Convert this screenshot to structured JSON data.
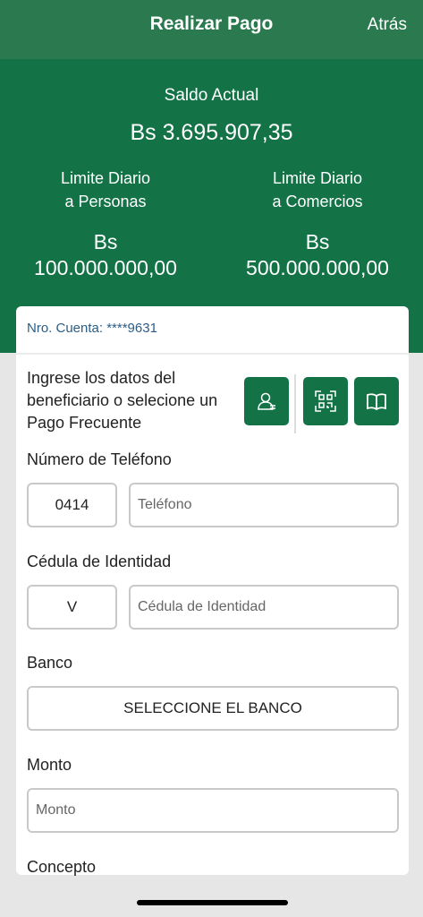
{
  "header": {
    "title": "Realizar Pago",
    "back_label": "Atrás"
  },
  "summary": {
    "balance_label": "Saldo Actual",
    "balance_value": "Bs  3.695.907,35",
    "limit_personas": {
      "label_line1": "Limite Diario",
      "label_line2": "a Personas",
      "currency": "Bs",
      "amount": "100.000.000,00"
    },
    "limit_comercios": {
      "label_line1": "Limite Diario",
      "label_line2": "a Comercios",
      "currency": "Bs",
      "amount": "500.000.000,00"
    }
  },
  "account": {
    "label": "Nro. Cuenta: ****9631"
  },
  "form": {
    "intro_text": "Ingrese los datos del beneficiario o selecione un Pago Frecuente",
    "actions": [
      {
        "icon": "contacts-icon"
      },
      {
        "icon": "qr-code-icon"
      },
      {
        "icon": "book-icon"
      }
    ],
    "phone": {
      "label": "Número de Teléfono",
      "prefix_value": "0414",
      "placeholder": "Teléfono"
    },
    "id_doc": {
      "label": "Cédula de Identidad",
      "type_value": "V",
      "placeholder": "Cédula de Identidad"
    },
    "bank": {
      "label": "Banco",
      "select_label": "SELECCIONE EL BANCO"
    },
    "amount": {
      "label": "Monto",
      "placeholder": "Monto"
    },
    "concept": {
      "label": "Concepto"
    }
  },
  "colors": {
    "header_bg": "#2b7a4f",
    "summary_bg": "#137246",
    "accent": "#137246",
    "account_text": "#2b5d86"
  }
}
